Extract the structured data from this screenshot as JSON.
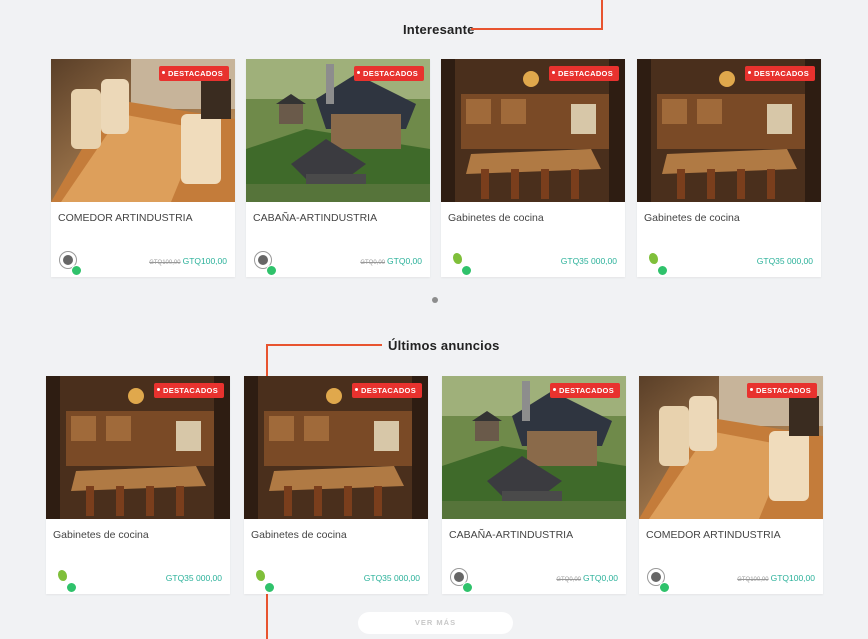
{
  "sections": {
    "interesante": {
      "title": "Interesante"
    },
    "ultimos": {
      "title": "Últimos anuncios"
    }
  },
  "interesante_cards": [
    {
      "badge": "DESTACADOS",
      "title": "COMEDOR ARTINDUSTRIA",
      "old_price": "GTQ100,00",
      "price": "GTQ100,00",
      "image": "dining"
    },
    {
      "badge": "DESTACADOS",
      "title": "CABAÑA-ARTINDUSTRIA",
      "old_price": "GTQ0,00",
      "price": "GTQ0,00",
      "image": "cabin"
    },
    {
      "badge": "DESTACADOS",
      "title": "Gabinetes de cocina",
      "old_price": "",
      "price": "GTQ35 000,00",
      "image": "kitchen"
    },
    {
      "badge": "DESTACADOS",
      "title": "Gabinetes de cocina",
      "old_price": "",
      "price": "GTQ35 000,00",
      "image": "kitchen"
    }
  ],
  "ultimos_cards": [
    {
      "badge": "DESTACADOS",
      "title": "Gabinetes de cocina",
      "old_price": "",
      "price": "GTQ35 000,00",
      "image": "kitchen"
    },
    {
      "badge": "DESTACADOS",
      "title": "Gabinetes de cocina",
      "old_price": "",
      "price": "GTQ35 000,00",
      "image": "kitchen"
    },
    {
      "badge": "DESTACADOS",
      "title": "CABAÑA-ARTINDUSTRIA",
      "old_price": "GTQ0,00",
      "price": "GTQ0,00",
      "image": "cabin"
    },
    {
      "badge": "DESTACADOS",
      "title": "COMEDOR ARTINDUSTRIA",
      "old_price": "GTQ100,00",
      "price": "GTQ100,00",
      "image": "dining"
    }
  ],
  "more_button": {
    "label": "VER MÁS"
  },
  "colors": {
    "badge": "#e8322e",
    "price": "#2bb19a",
    "online": "#2fc26b",
    "annotation": "#e8542f"
  }
}
